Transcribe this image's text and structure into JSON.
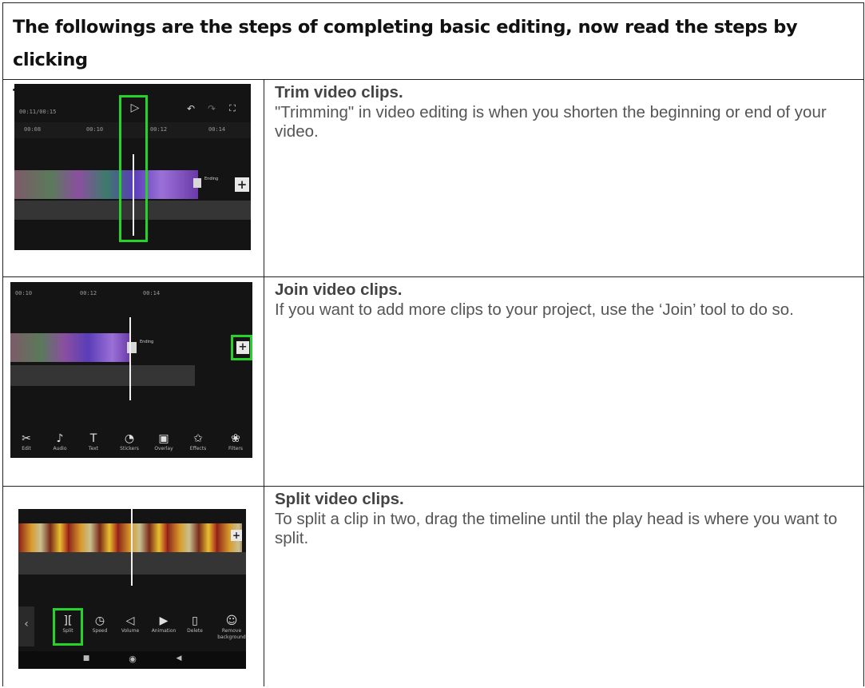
{
  "header": {
    "line1": "The followings are the steps of completing basic editing, now read the steps by clicking",
    "line2": "the microphone!"
  },
  "steps": [
    {
      "title": "Trim video clips.",
      "description": "\"Trimming\" in video editing is when you shorten the beginning or end of your video.",
      "screenshot": {
        "timecode": "00:11/00:15",
        "ticks": [
          "00:08",
          "00:10",
          "00:12",
          "00:14"
        ],
        "ending_label": "Ending"
      }
    },
    {
      "title": "Join video clips.",
      "description": "If you want to add more clips to your project, use the ‘Join’ tool to do so.",
      "screenshot": {
        "ticks": [
          "00:10",
          "00:12",
          "00:14"
        ],
        "ending_label": "Ending",
        "tools": [
          "Edit",
          "Audio",
          "Text",
          "Stickers",
          "Overlay",
          "Effects",
          "Filters"
        ]
      }
    },
    {
      "title": "Split video clips.",
      "description": "To split a clip in two, drag the timeline until the play head is where you want to split.",
      "screenshot": {
        "tools": [
          "Split",
          "Speed",
          "Volume",
          "Animation",
          "Delete",
          "Remove background"
        ]
      }
    }
  ],
  "colors": {
    "highlight": "#27d22a",
    "app_background": "#141414",
    "text": "#555555"
  }
}
